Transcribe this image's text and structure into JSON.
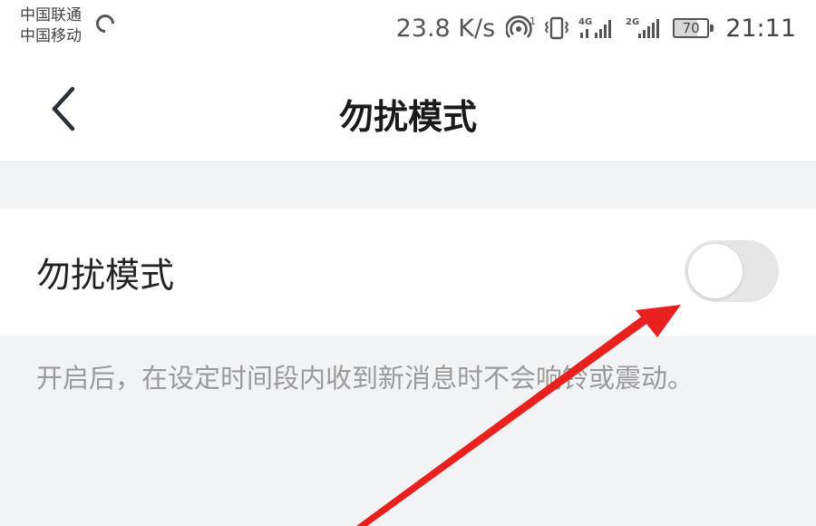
{
  "status_bar": {
    "carrier_1": "中国联通",
    "carrier_2": "中国移动",
    "net_speed": "23.8 K/s",
    "hotspot_count": "1",
    "network_1": "4G",
    "network_2": "2G",
    "battery_level": "70",
    "time": "21:11",
    "icons": [
      "loading-icon",
      "hotspot-icon",
      "vibrate-icon",
      "signal-4g-icon",
      "signal-2g-icon",
      "battery-icon"
    ]
  },
  "header": {
    "title": "勿扰模式",
    "back_icon": "chevron-left-icon"
  },
  "settings": {
    "dnd_label": "勿扰模式",
    "dnd_enabled": false,
    "description": "开启后，在设定时间段内收到新消息时不会响铃或震动。"
  },
  "colors": {
    "background": "#f2f3f5",
    "surface": "#ffffff",
    "toggle_off": "#e6e6e6",
    "annotation_arrow": "#e8201e",
    "hint_text": "#9a9a9a"
  }
}
